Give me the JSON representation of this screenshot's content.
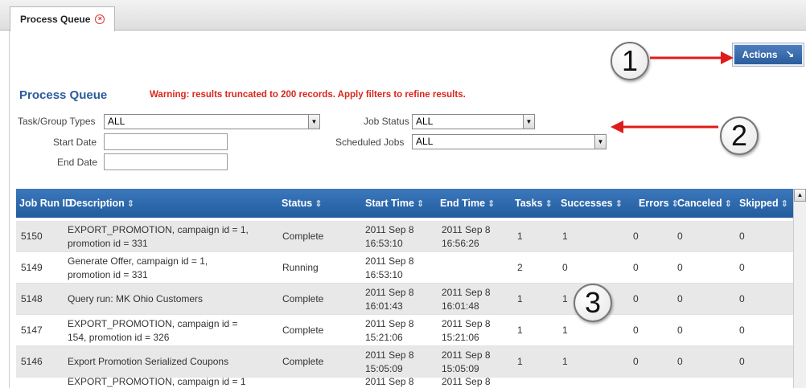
{
  "tab": {
    "label": "Process Queue",
    "close_icon": "close-circle-icon"
  },
  "actions": {
    "label": "Actions",
    "icon": "arrow-down-right-icon"
  },
  "callouts": [
    "1",
    "2",
    "3"
  ],
  "page_title": "Process Queue",
  "warning": "Warning: results truncated to 200 records.  Apply filters to refine results.",
  "filters": {
    "task_group_types": {
      "label": "Task/Group Types",
      "value": "ALL"
    },
    "start_date": {
      "label": "Start Date",
      "value": ""
    },
    "end_date": {
      "label": "End Date",
      "value": ""
    },
    "job_status": {
      "label": "Job Status",
      "value": "ALL"
    },
    "scheduled_jobs": {
      "label": "Scheduled Jobs",
      "value": "ALL"
    }
  },
  "table": {
    "columns": [
      "Job Run ID",
      "Description",
      "Status",
      "Start Time",
      "End Time",
      "Tasks",
      "Successes",
      "Errors",
      "Canceled",
      "Skipped"
    ],
    "rows": [
      {
        "id": "5150",
        "desc1": "EXPORT_PROMOTION, campaign id = 1,",
        "desc2": "promotion id = 331",
        "status": "Complete",
        "start1": "2011 Sep 8",
        "start2": "16:53:10",
        "end1": "2011 Sep 8",
        "end2": "16:56:26",
        "tasks": "1",
        "successes": "1",
        "errors": "0",
        "canceled": "0",
        "skipped": "0"
      },
      {
        "id": "5149",
        "desc1": "Generate Offer, campaign id = 1,",
        "desc2": "promotion id = 331",
        "status": "Running",
        "start1": "2011 Sep 8",
        "start2": "16:53:10",
        "end1": "",
        "end2": "",
        "tasks": "2",
        "successes": "0",
        "errors": "0",
        "canceled": "0",
        "skipped": "0"
      },
      {
        "id": "5148",
        "desc1": "Query run: MK Ohio Customers",
        "desc2": "",
        "status": "Complete",
        "start1": "2011 Sep 8",
        "start2": "16:01:43",
        "end1": "2011 Sep 8",
        "end2": "16:01:48",
        "tasks": "1",
        "successes": "1",
        "errors": "0",
        "canceled": "0",
        "skipped": "0"
      },
      {
        "id": "5147",
        "desc1": "EXPORT_PROMOTION, campaign id =",
        "desc2": "154, promotion id = 326",
        "status": "Complete",
        "start1": "2011 Sep 8",
        "start2": "15:21:06",
        "end1": "2011 Sep 8",
        "end2": "15:21:06",
        "tasks": "1",
        "successes": "1",
        "errors": "0",
        "canceled": "0",
        "skipped": "0"
      },
      {
        "id": "5146",
        "desc1": "Export Promotion Serialized Coupons",
        "desc2": "",
        "status": "Complete",
        "start1": "2011 Sep 8",
        "start2": "15:05:09",
        "end1": "2011 Sep 8",
        "end2": "15:05:09",
        "tasks": "1",
        "successes": "1",
        "errors": "0",
        "canceled": "0",
        "skipped": "0"
      },
      {
        "id": "",
        "desc1": "EXPORT_PROMOTION, campaign id = 1",
        "desc2": "",
        "status": "",
        "start1": "2011 Sep 8",
        "start2": "",
        "end1": "2011 Sep 8",
        "end2": "",
        "tasks": "",
        "successes": "",
        "errors": "",
        "canceled": "",
        "skipped": ""
      }
    ]
  },
  "colors": {
    "accent": "#2b5c9c",
    "warning": "#d9261c",
    "header": "#2f6aae",
    "arrow": "#e01b1b"
  }
}
